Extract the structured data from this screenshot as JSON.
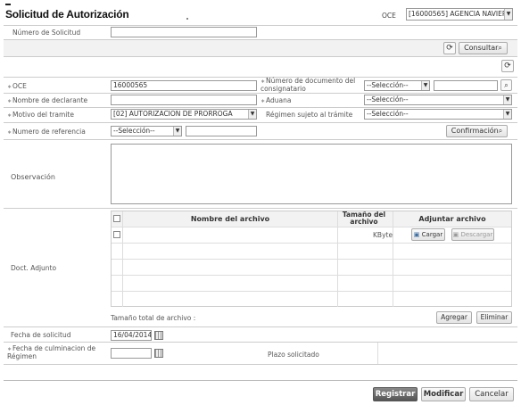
{
  "header": {
    "title": "Solicitud de Autorización",
    "oce_label": "OCE",
    "oce_value": "[16000565] AGENCIA NAVIERA"
  },
  "search": {
    "numero_label": "Número de Solicitud",
    "numero_value": "",
    "consultar_label": "Consultar"
  },
  "form": {
    "oce_label": "OCE",
    "oce_value": "16000565",
    "numdoc_label": "Número de documento del consignatario",
    "numdoc_select": "--Selección--",
    "numdoc_value": "",
    "nombre_label": "Nombre de declarante",
    "nombre_value": "",
    "aduana_label": "Aduana",
    "aduana_value": "--Selección--",
    "motivo_label": "Motivo del tramite",
    "motivo_value": "[02] AUTORIZACION DE PRORROGA",
    "regimen_label": "Régimen sujeto al trámite",
    "regimen_value": "--Selección--",
    "referencia_label": "Numero de referencia",
    "referencia_select": "--Selección--",
    "referencia_value": "",
    "confirmacion_label": "Confirmación",
    "observacion_label": "Observación",
    "observacion_value": ""
  },
  "attachments": {
    "label": "Doct. Adjunto",
    "col_name": "Nombre del archivo",
    "col_size": "Tamaño del archivo",
    "col_action": "Adjuntar archivo",
    "row_unit": "KByte",
    "cargar_label": "Cargar",
    "descargar_label": "Descargar",
    "total_label": "Tamaño total de archivo :",
    "agregar_label": "Agregar",
    "eliminar_label": "Eliminar"
  },
  "dates": {
    "fecha_label": "Fecha de solicitud",
    "fecha_value": "16/04/2014",
    "culminacion_label": "Fecha de culminacion de Régimen",
    "culminacion_value": "",
    "plazo_label": "Plazo solicitado"
  },
  "footer": {
    "registrar_label": "Registrar",
    "modificar_label": "Modificar",
    "cancelar_label": "Cancelar"
  },
  "colors": {
    "accent_dark": "#555555",
    "row_bg": "#f2f2f2"
  }
}
